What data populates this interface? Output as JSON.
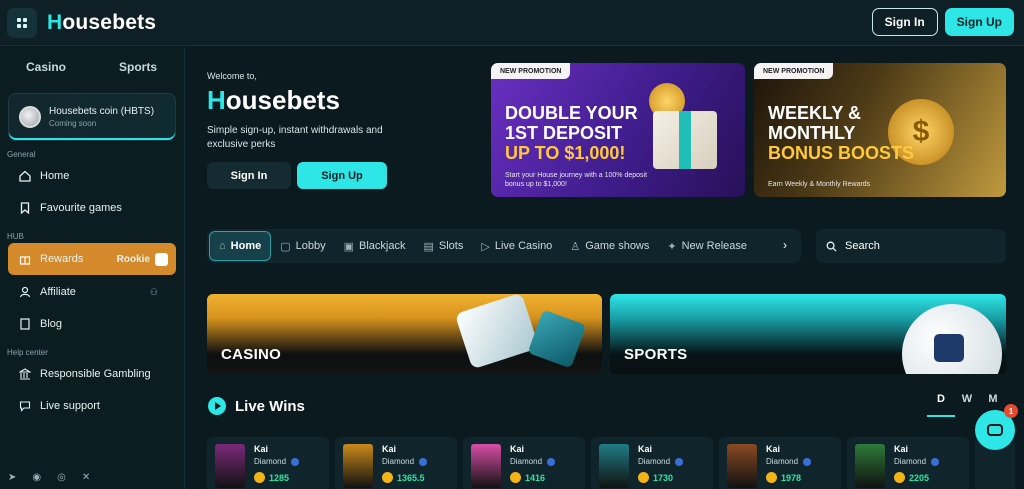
{
  "header": {
    "logo_h": "H",
    "logo_rest": "ousebets",
    "signin_label": "Sign In",
    "signup_label": "Sign Up"
  },
  "sidebar": {
    "tabs": [
      "Casino",
      "Sports"
    ],
    "coin": {
      "title": "Housebets coin (HBTS)",
      "subtitle": "Coming soon"
    },
    "section_general": "General",
    "section_hub": "HUB",
    "section_help": "Help center",
    "items": {
      "home": "Home",
      "favourites": "Favourite games",
      "rewards": "Rewards",
      "rookie": "Rookie",
      "affiliate": "Affiliate",
      "blog": "Blog",
      "responsible": "Responsible Gambling",
      "support": "Live support"
    }
  },
  "welcome": {
    "small": "Welcome to,",
    "logo_h": "H",
    "logo_rest": "ousebets",
    "description": "Simple sign-up, instant withdrawals and exclusive perks",
    "signin_label": "Sign In",
    "signup_label": "Sign Up"
  },
  "promos": [
    {
      "tag": "NEW PROMOTION",
      "line1": "DOUBLE YOUR",
      "line2": "1ST DEPOSIT",
      "line3": "UP TO $1,000!",
      "footer": "Start your House journey with a 100% deposit bonus up to $1,000!"
    },
    {
      "tag": "NEW PROMOTION",
      "line1": "WEEKLY &",
      "line2": "MONTHLY",
      "line3": "BONUS BOOSTS",
      "footer": "Earn Weekly & Monthly Rewards"
    }
  ],
  "nav": {
    "tabs": [
      "Home",
      "Lobby",
      "Blackjack",
      "Slots",
      "Live Casino",
      "Game shows",
      "New Release"
    ],
    "search_placeholder": "Search"
  },
  "banners": {
    "casino": "CASINO",
    "sports": "SPORTS"
  },
  "live_wins": {
    "title": "Live Wins",
    "periods": [
      "D",
      "W",
      "M"
    ],
    "entries": [
      {
        "name": "Kai",
        "rank": "Diamond",
        "amount": "1285",
        "thumb_color": "#7a2a7a"
      },
      {
        "name": "Kai",
        "rank": "Diamond",
        "amount": "1365.5",
        "thumb_color": "#c98a1a"
      },
      {
        "name": "Kai",
        "rank": "Diamond",
        "amount": "1416",
        "thumb_color": "#d94fa8"
      },
      {
        "name": "Kai",
        "rank": "Diamond",
        "amount": "1730",
        "thumb_color": "#1f7d86"
      },
      {
        "name": "Kai",
        "rank": "Diamond",
        "amount": "1978",
        "thumb_color": "#8a4a22"
      },
      {
        "name": "Kai",
        "rank": "Diamond",
        "amount": "2205",
        "thumb_color": "#2d7a3a"
      }
    ]
  },
  "chat": {
    "badge": "1"
  }
}
